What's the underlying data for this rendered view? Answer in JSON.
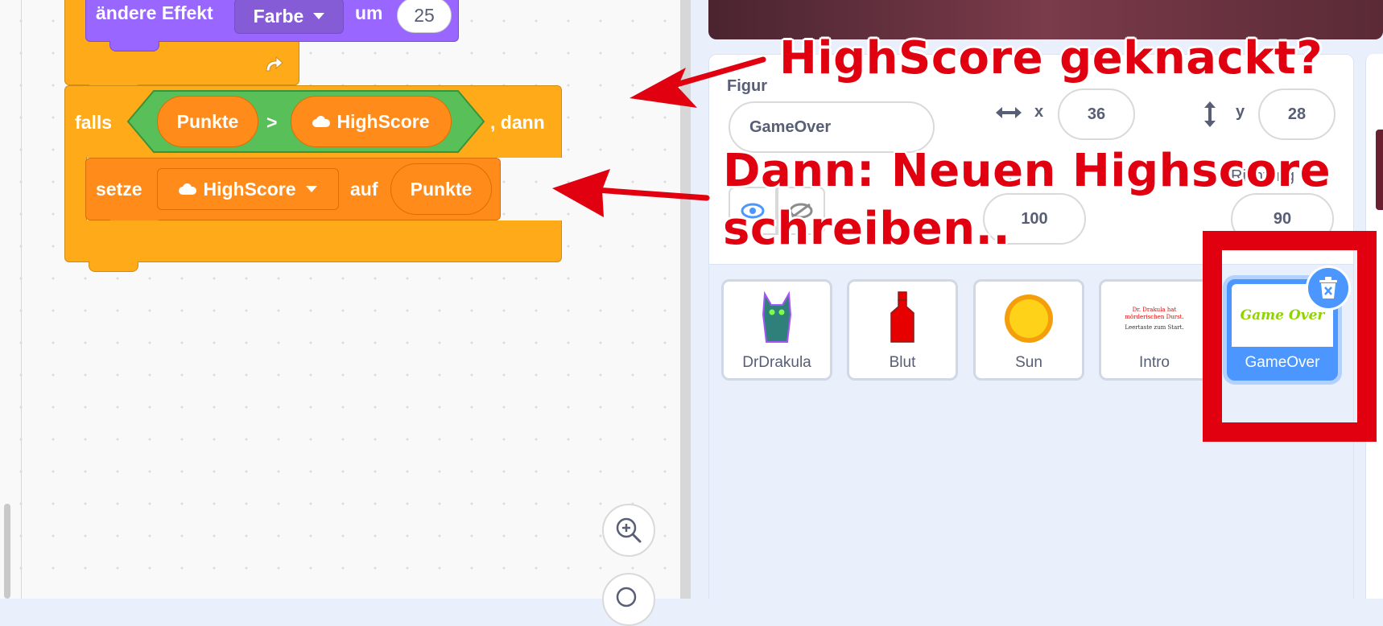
{
  "code_area": {
    "effect_block": {
      "label": "ändere Effekt",
      "dropdown": "Farbe",
      "um_label": "um",
      "value": "25"
    },
    "if_block": {
      "falls_label": "falls",
      "left_reporter": "Punkte",
      "operator": ">",
      "right_reporter": "HighScore",
      "dann_label": ", dann"
    },
    "set_block": {
      "label": "setze",
      "variable": "HighScore",
      "auf_label": "auf",
      "value": "Punkte"
    }
  },
  "sprite_info": {
    "figur_label": "Figur",
    "sprite_name": "GameOver",
    "x_label": "x",
    "x_value": "36",
    "y_label": "y",
    "y_value": "28",
    "size_label_fragment": "ß",
    "size_value": "100",
    "direction_label": "Richtung",
    "direction_value": "90"
  },
  "sprites": [
    {
      "name": "DrDrakula",
      "selected": false
    },
    {
      "name": "Blut",
      "selected": false
    },
    {
      "name": "Sun",
      "selected": false
    },
    {
      "name": "Intro",
      "selected": false,
      "thumb_text_line1": "Dr. Drakula hat",
      "thumb_text_line2": "mörderischen Durst.",
      "thumb_text_line3": "Leertaste zum Start."
    },
    {
      "name": "GameOver",
      "selected": true,
      "thumb_text": "Game Over"
    }
  ],
  "annotations": {
    "line1": "HighScore geknackt?",
    "line2": "Dann: Neuen Highscore",
    "line3": "schreiben..",
    "color": "#e1000f"
  },
  "colors": {
    "control": "#ffab19",
    "variables": "#ff8c1a",
    "looks": "#9966ff",
    "operators": "#59c059",
    "selected_sprite": "#4c97ff"
  },
  "icons": [
    "turn-arrow-icon",
    "cloud-icon",
    "dropdown-caret-icon",
    "zoom-in-icon",
    "zoom-out-icon",
    "arrows-horizontal-icon",
    "arrows-vertical-icon",
    "delete-icon"
  ]
}
